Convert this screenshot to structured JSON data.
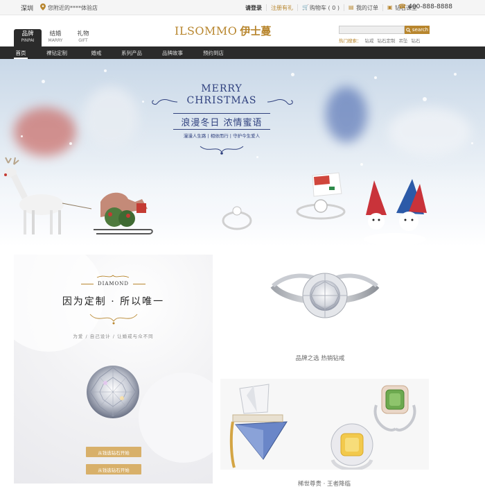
{
  "topbar": {
    "city": "深圳",
    "nearby_store": "您附近的****体验店",
    "login": "请登录",
    "register": "注册有礼",
    "cart": "购物车 ( 0 )",
    "orders": "我的订单",
    "classroom": "钻石课堂",
    "phone": "400-888-8888"
  },
  "header": {
    "tabs": [
      {
        "cn": "品牌",
        "en": "PINPAI"
      },
      {
        "cn": "结婚",
        "en": "MARRY"
      },
      {
        "cn": "礼物",
        "en": "GIFT"
      }
    ],
    "logo_en": "ILSOMMO",
    "logo_cn": "伊士蔓",
    "search_button": "search",
    "hot_label": "热门搜索：",
    "hot_items": [
      "钻戒",
      "钻石定制",
      "吊坠",
      "钻石"
    ]
  },
  "mainnav": [
    "首页",
    "裸钻定制",
    "婚戒",
    "系列产品",
    "品牌故事",
    "预约到店"
  ],
  "hero": {
    "title_line1": "MERRY",
    "title_line2": "CHRISTMAS",
    "cn_title": "浪漫冬日 浓情蜜语",
    "subtitle": "漫漫人生路 | 相依而行 | 守护今生爱人"
  },
  "diamond_panel": {
    "label": "DIAMOND",
    "slogan": "因为定制 · 所以唯一",
    "tagline": "为爱 / 自己设计 / 让婚戒与众不同",
    "button1": "从钱选钻石开始",
    "button2": "从钱选钻石开始"
  },
  "products": {
    "ring_title": "品牌之选 热销钻戒",
    "gems_title": "稀世尊贵 · 王者降临"
  },
  "colors": {
    "gold": "#b8862e",
    "dark": "#2b2b2b",
    "navy": "#2e3f7d"
  }
}
